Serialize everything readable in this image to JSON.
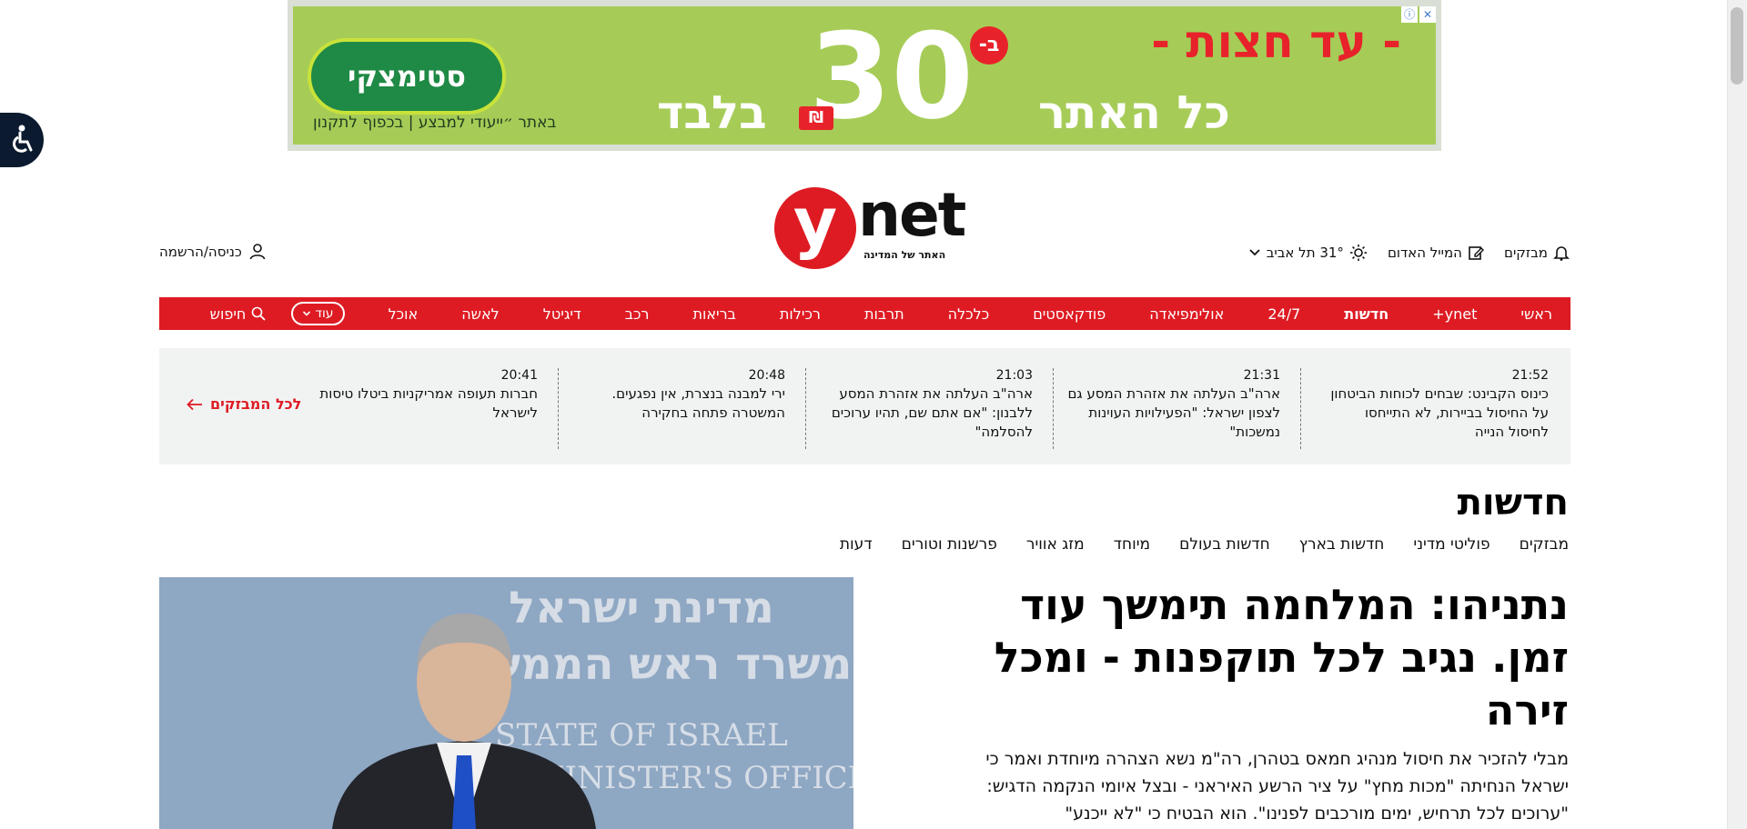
{
  "ad": {
    "headline": "- עד חצות -",
    "big_number": "30",
    "percent_marker": "ב-",
    "shekel": "₪",
    "subline": "כל האתר",
    "only": "בלבד",
    "brand": "סטימצקי",
    "tagline": "באתר ״ייעודי למבצע | בכפוף לתקנון",
    "info_icon": "info-icon",
    "close_icon": "close-icon",
    "colors": {
      "background": "#a6cc57",
      "headline": "#e8222a",
      "brand_bg": "#1f8a45"
    }
  },
  "header": {
    "login_label": "כניסה/הרשמה",
    "logo_y": "y",
    "logo_net": "net",
    "logo_tagline": "האתר של המדינה",
    "tools": {
      "alerts_label": "מבזקים",
      "red_mail_label": "המייל האדום",
      "weather_label": "31° תל אביב"
    }
  },
  "nav": {
    "items": [
      {
        "label": "ראשי",
        "bold": false
      },
      {
        "label": "ynet+",
        "bold": false
      },
      {
        "label": "חדשות",
        "bold": true
      },
      {
        "label": "24/7",
        "bold": false
      },
      {
        "label": "אולימפיאדה",
        "bold": false
      },
      {
        "label": "פודקאסטים",
        "bold": false
      },
      {
        "label": "כלכלה",
        "bold": false
      },
      {
        "label": "תרבות",
        "bold": false
      },
      {
        "label": "רכילות",
        "bold": false
      },
      {
        "label": "בריאות",
        "bold": false
      },
      {
        "label": "רכב",
        "bold": false
      },
      {
        "label": "דיגיטל",
        "bold": false
      },
      {
        "label": "לאשה",
        "bold": false
      },
      {
        "label": "אוכל",
        "bold": false
      }
    ],
    "more_label": "עוד",
    "search_label": "חיפוש",
    "color": "#de1b23"
  },
  "flash": {
    "items": [
      {
        "time": "21:52",
        "text": "כינוס הקבינט: שבחים לכוחות הביטחון על החיסול בביירות, לא התייחסו לחיסול הנייה"
      },
      {
        "time": "21:31",
        "text": "ארה\"ב העלתה את אזהרת המסע גם לצפון ישראל: \"הפעילויות העוינות נמשכות\""
      },
      {
        "time": "21:03",
        "text": "ארה\"ב העלתה את אזהרת המסע ללבנון: \"אם אתם שם, תהיו ערוכים להסלמה\""
      },
      {
        "time": "20:48",
        "text": "ירי למבנה בנצרת, אין נפגעים. המשטרה פתחה בחקירה"
      },
      {
        "time": "20:41",
        "text": "חברות תעופה אמריקניות ביטלו טיסות לישראל"
      }
    ],
    "all_label": "לכל המבזקים"
  },
  "section": {
    "title": "חדשות",
    "subnav": [
      "מבזקים",
      "פוליטי מדיני",
      "חדשות בארץ",
      "חדשות בעולם",
      "מיוחד",
      "מזג אוויר",
      "פרשנות וטורים",
      "דעות"
    ]
  },
  "main_story": {
    "title": "נתניהו: המלחמה תימשך עוד זמן. נגיב לכל תוקפנות - ומכל זירה",
    "subtitle": "מבלי להזכיר את חיסול מנהיג חמאס בטהרן, רה\"מ נשא הצהרה מיוחדת ואמר כי ישראל הנחיתה \"מכות מחץ\" על ציר הרשע האיראני - ובצל איומי הנקמה הדגיש: \"ערוכים לכל תרחיש, ימים מורכבים לפנינו\". הוא הבטיח כי \"לא ייכנע\"",
    "image_sign_line1": "מדינת ישראל",
    "image_sign_line2": "משרד ראש הממשלה",
    "image_sign_en1": "STATE OF ISRAEL",
    "image_sign_en2": "PRIME MINISTER'S OFFICE"
  }
}
